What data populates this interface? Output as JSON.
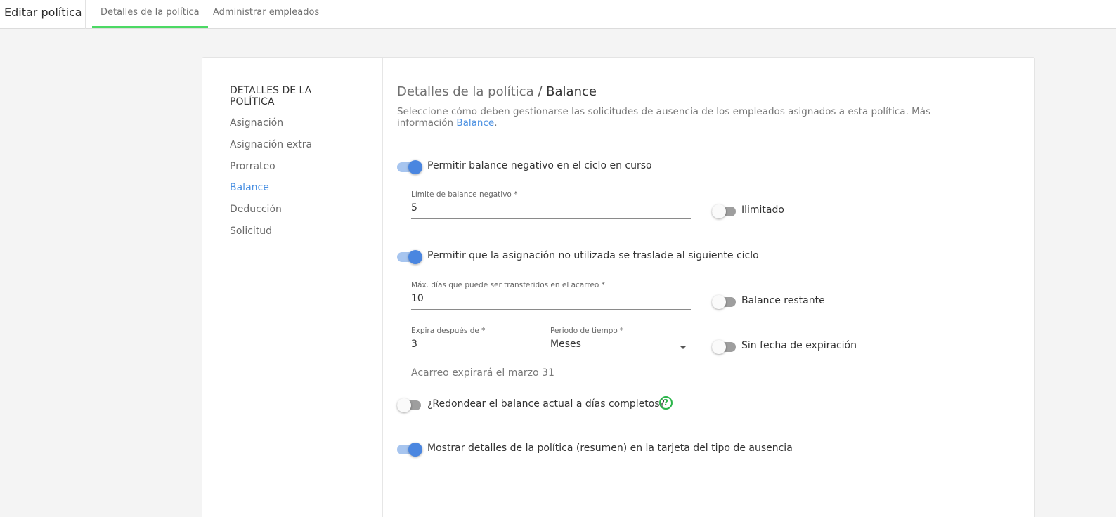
{
  "header": {
    "title": "Editar política",
    "tabs": [
      {
        "label": "Detalles de la política",
        "active": true
      },
      {
        "label": "Administrar empleados",
        "active": false
      }
    ],
    "active_tab_color": "#4cd964"
  },
  "sidebar": {
    "heading": "DETALLES DE LA POLÍTICA",
    "items": [
      {
        "label": "Asignación"
      },
      {
        "label": "Asignación extra"
      },
      {
        "label": "Prorrateo"
      },
      {
        "label": "Balance",
        "active": true
      },
      {
        "label": "Deducción"
      },
      {
        "label": "Solicitud"
      }
    ]
  },
  "main": {
    "breadcrumb": {
      "parent": "Detalles de la política",
      "separator": "/",
      "current": "Balance"
    },
    "description": {
      "text": "Seleccione cómo deben gestionarse las solicitudes de ausencia de los empleados asignados a esta política. Más información",
      "link": "Balance",
      "suffix": "."
    },
    "negative_balance": {
      "label": "Permitir balance negativo en el ciclo en curso",
      "on": true,
      "limit_label": "Límite de balance negativo *",
      "limit_value": "5",
      "unlimited_label": "Ilimitado",
      "unlimited_on": false
    },
    "carryover": {
      "label": "Permitir que la asignación no utilizada se traslade al siguiente ciclo",
      "on": true,
      "max_days_label": "Máx. días que puede ser transferidos en el acarreo *",
      "max_days_value": "10",
      "remaining_label": "Balance restante",
      "remaining_on": false,
      "expires_label": "Expira después de *",
      "expires_value": "3",
      "period_label": "Periodo de tiempo *",
      "period_value": "Meses",
      "no_expiry_label": "Sin fecha de expiración",
      "no_expiry_on": false,
      "note": "Acarreo expirará el marzo 31"
    },
    "round_balance": {
      "label": "¿Redondear el balance actual a días completos?",
      "on": false,
      "help_icon": "question-circle-icon"
    },
    "show_details": {
      "label": "Mostrar detalles de la política (resumen) en la tarjeta del tipo de ausencia",
      "on": true
    }
  },
  "colors": {
    "accent": "#4a90e2",
    "toggle_on_thumb": "#4a86e0",
    "toggle_on_track": "#a7c5ef",
    "help": "#2bb54a"
  }
}
